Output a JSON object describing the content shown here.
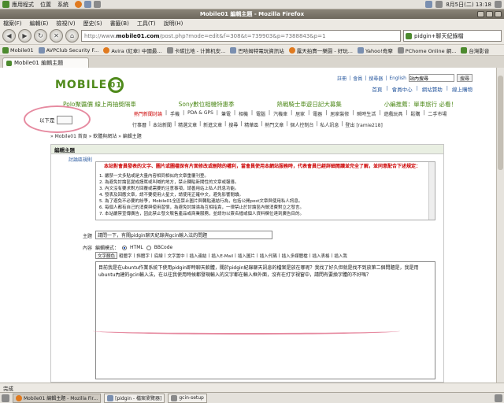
{
  "gnome_panel": {
    "menus": [
      "應用程式",
      "位置",
      "系統"
    ],
    "clock": "8月5日(二) 13:18"
  },
  "window": {
    "title": "Mobile01 編輯主題 - Mozilla Firefox"
  },
  "menubar": [
    "檔案(F)",
    "編輯(E)",
    "檢視(V)",
    "歷史(S)",
    "書籤(B)",
    "工具(T)",
    "說明(H)"
  ],
  "navbar": {
    "url_gray": "http://www.",
    "url_bold": "mobile01.com",
    "url_tail": "/post.php?mode=edit&f=308&t=739903&p=7388843&p=1",
    "search_text": "pidgin+聊天紀錄檔"
  },
  "bookmarks": [
    "Mobile01",
    "AVPClub Security F...",
    "Avira (紅傘) 中國最...",
    "卡碳比地 - 计算机安...",
    "巴哈姆特電玩資訊站",
    "露天拍賣一樂園 - 好玩...",
    "Yahoo!奇摩",
    "PChome Online 網...",
    "台灣影音"
  ],
  "tab": {
    "label": "Mobile01 編輯主題"
  },
  "page": {
    "logo": "MOBILE",
    "logo_ring": "01",
    "top_links": [
      "註冊",
      "|",
      "會員",
      "|",
      "搜尋器",
      "|",
      "English"
    ],
    "search_value": "站內搜尋",
    "search_button": "搜尋",
    "sub_links": [
      "首頁",
      "|",
      "會員中心",
      "|",
      "網站贊助",
      "|",
      "線上購物"
    ],
    "promos": [
      "Polo聚醬價 線上再抽獎隔車",
      "Sony數位相機特惠季",
      "熱戰騎士車遊日記大募集",
      "小編推薦：單車旅行 必看！"
    ],
    "categories": [
      "熱門新聞討論",
      "|",
      "手機",
      "|",
      "PDA & GPS",
      "|",
      "筆電",
      "|",
      "相機",
      "|",
      "電腦",
      "|",
      "汽機車",
      "|",
      "居家",
      "|",
      "電器",
      "|",
      "居家裝修",
      "|",
      "瞬時生活",
      "|",
      "遊戲玩具",
      "|",
      "鬆購",
      "|",
      "二手市場"
    ],
    "lang_label": "以下是",
    "forum_links": [
      "行事曆",
      "|",
      "本站新聞",
      "|",
      "精選文章",
      "|",
      "新進文章",
      "|",
      "搜尋",
      "|",
      "精華區",
      "|",
      "熱門文章",
      "|",
      "個人控制台",
      "|",
      "私人訊息",
      "|",
      "登出 [ramie218]"
    ],
    "breadcrumb": "» Mobile01 首頁 » 軟體與網站 » 編輯主題",
    "panel_title": "編輯主題",
    "rules_label": "討論區規則",
    "rules_warning": "本站對會員發表的文字、圖片或圖檔保有片面修改或刪除的權利，當會員使用本網站服務時，代表會員已經詳細閱讀並完全了解，並同意配合下述規定：",
    "rules_lines": [
      "1. 嚴禁一文多貼或是大量內容相同相似的文章重覆刊登。",
      "2. 為避免討論區變成謾罵或叫喊的地方，禁止轉貼新聞性的文章或報導。",
      "3. 內文沒有要求對方回覆或需要的注意事項，請善用站上私人訊息功能。",
      "4. 發表及回應文章，請不要使用火星文，請使用正確中文，避免影響閱讀。",
      "5. 為了避免不必要的紛爭，Mobile01全區禁止圖片與轉貼連結行為，包括公開post文章與使用私人訊息。",
      "6. 每個人都有自己的消費與使用習慣，為避免討論淪為互相指責，一律禁止於討論區內做消費對立之發言。",
      "7. 本站嚴禁宣傳廣告，因此禁止發文販售產品或商業服務，並請勿以簽名檔或個人資料欄位達到廣告目的。"
    ],
    "subject_label": "主題",
    "subject_value": "請問一下，有關pidgin聊天紀錄與gcin輸入法的問題",
    "content_label": "內容",
    "mode_label": "編輯模式：",
    "mode_html": "HTML",
    "mode_bbcode": "BBCode",
    "toolbar": [
      "文字顏色",
      "粗體字",
      "斜體字",
      "底線",
      "文字置中",
      "插入連結",
      "插入E-Mail",
      "插入圖片",
      "插入代碼",
      "插入多媒體檔",
      "插入表格",
      "插入我"
    ],
    "editor_text": "目前我是在ubuntu作業系統下使用pidgin即時聊天軟體，關於pidgin紀錄聊天訊息的檔案是放在哪呢？我找了好久但就是找不到放第二個問題是，我是用ubuntu內建的gcin輸入法，在以往我使用時候都發現輸入的文字都在輸入框外面，沒有在打字視窗中，請問有要換字體的不好嗎？"
  },
  "statusbar": {
    "text": "完成"
  },
  "taskbar": [
    "Mobile01 編輯主題 - Mozilla Fir...",
    "[pidgin - 檔案瀏覽器]",
    "gcin-setup"
  ]
}
